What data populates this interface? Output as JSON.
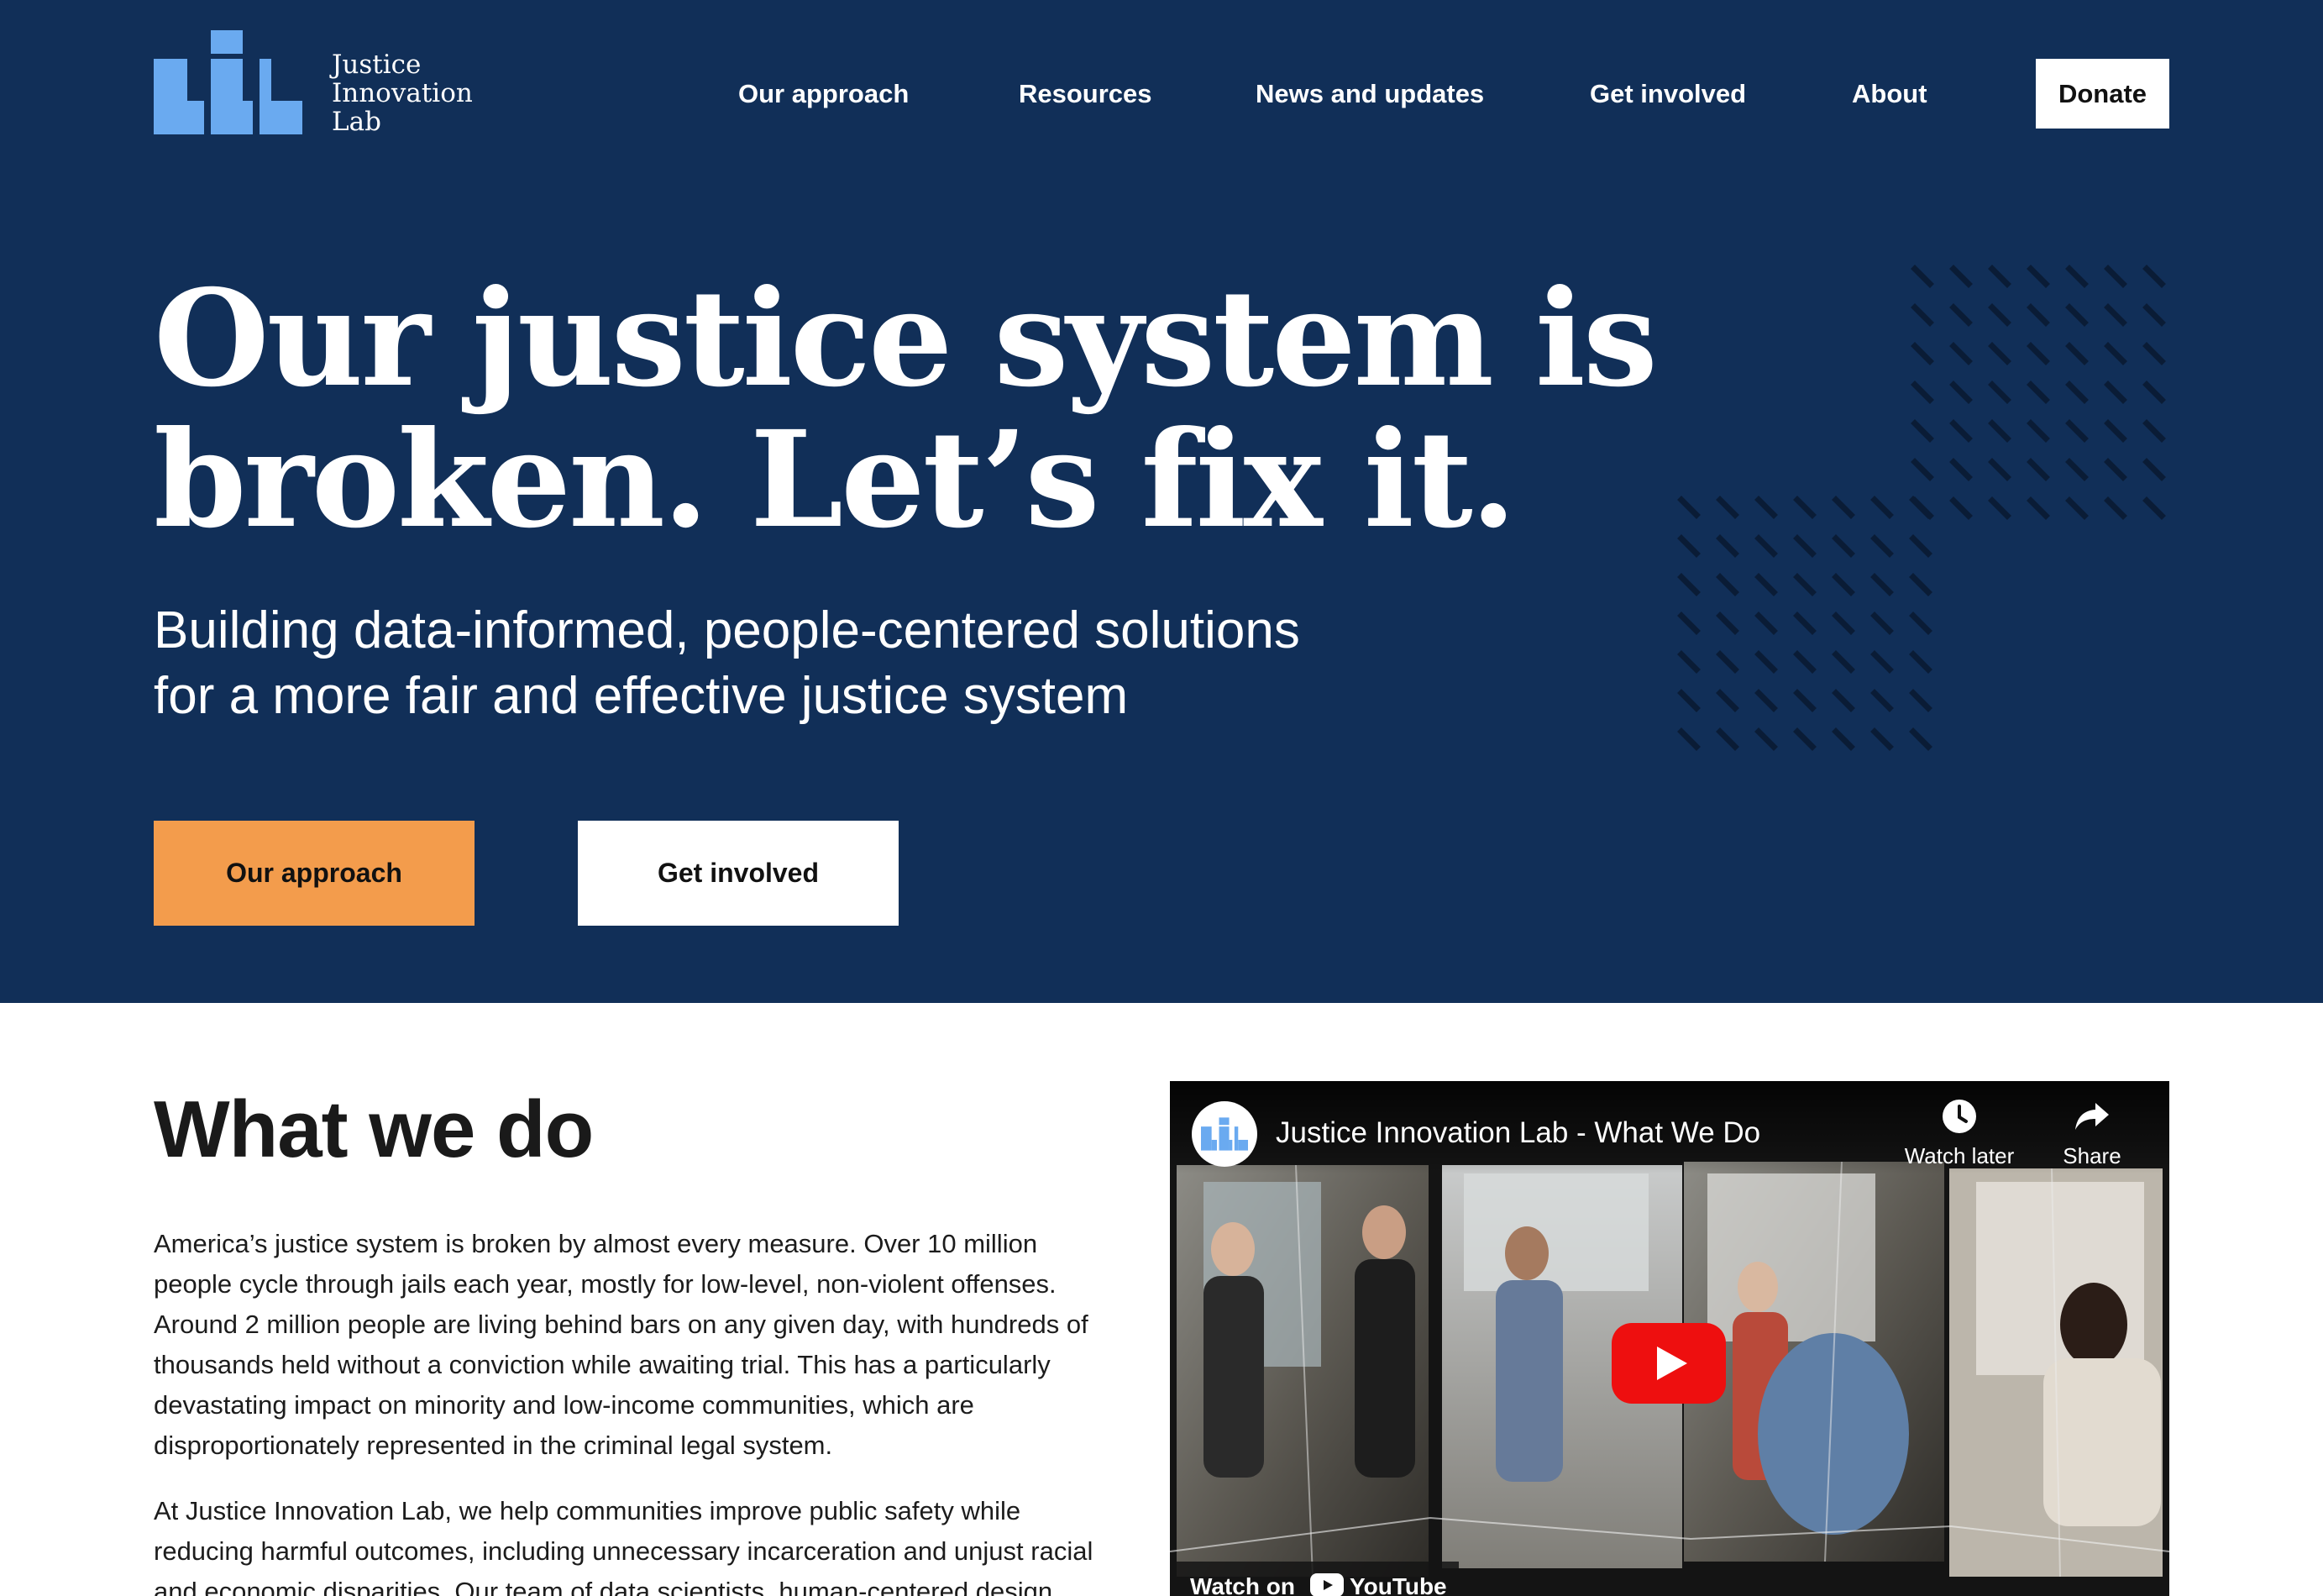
{
  "brand": {
    "logo_lines": [
      "Justice",
      "Innovation",
      "Lab"
    ],
    "colors": {
      "hero_bg": "#112f58",
      "accent_orange": "#f39c4c",
      "logo_blue": "#6aaaf0",
      "white": "#ffffff"
    }
  },
  "nav": {
    "items": [
      {
        "label": "Our approach"
      },
      {
        "label": "Resources"
      },
      {
        "label": "News and updates"
      },
      {
        "label": "Get involved"
      },
      {
        "label": "About"
      }
    ],
    "donate_label": "Donate"
  },
  "hero": {
    "title_lines": [
      "Our justice system is",
      "broken. Let’s fix it."
    ],
    "subtitle_lines": [
      "Building data-informed, people-centered solutions",
      "for a more fair and effective justice system"
    ],
    "primary_button": "Our approach",
    "secondary_button": "Get involved"
  },
  "what_we_do": {
    "title": "What we do",
    "paragraph_1_lines": [
      "America’s justice system is broken by almost every measure. Over 10 million",
      "people cycle through jails each year, mostly for low-level, non-violent offenses.",
      "Around 2 million people are living behind bars on any given day, with hundreds of",
      "thousands held without a conviction while awaiting trial. This has a particularly",
      "devastating impact on minority and low-income communities, which are",
      "disproportionately represented in the criminal legal system."
    ],
    "paragraph_2_lines": [
      "At Justice Innovation Lab, we help communities improve public safety while",
      "reducing harmful outcomes, including unnecessary incarceration and unjust racial",
      "and economic disparities. Our team of data scientists, human-centered design"
    ]
  },
  "video": {
    "title": "Justice Innovation Lab - What We Do",
    "watch_later": "Watch later",
    "share": "Share",
    "watch_on": "Watch on",
    "platform": "YouTube",
    "icons": {
      "watch_later": "clock-icon",
      "share": "share-arrow-icon",
      "play": "play-icon"
    }
  }
}
